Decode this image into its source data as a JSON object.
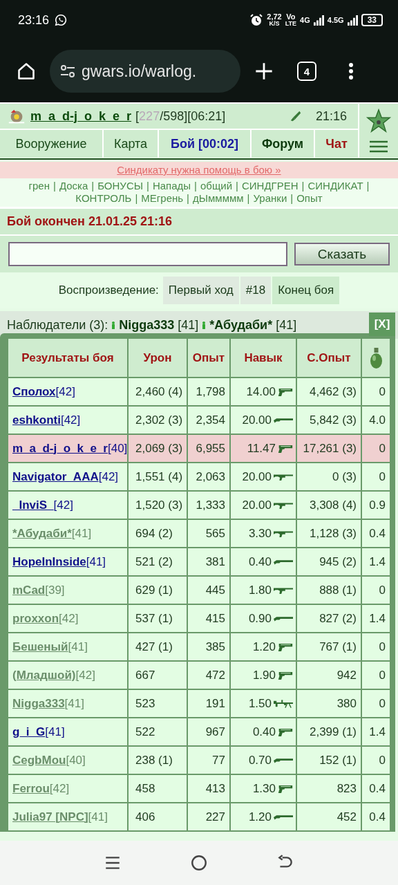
{
  "status_bar": {
    "time": "23:16",
    "speed": "2,72",
    "speed_unit": "K/S",
    "volte_top": "Vo",
    "volte_bottom": "LTE",
    "net_1": "4G",
    "net_2": "4.5G",
    "battery": "33"
  },
  "browser": {
    "url": "gwars.io/warlog.",
    "tab_count": "4"
  },
  "header": {
    "player": "m_a_d-j_o_k_e_r",
    "bracket": "[",
    "hp": "227",
    "hp_rest": "/598][06:21]",
    "time": "21:16"
  },
  "tabs": [
    {
      "label": "Вооружение",
      "kind": "plain"
    },
    {
      "label": "Карта",
      "kind": "plain"
    },
    {
      "label": "Бой [00:02]",
      "kind": "battle"
    },
    {
      "label": "Форум",
      "kind": "bold"
    },
    {
      "label": "Чат",
      "kind": "chat"
    }
  ],
  "banner": "Синдикату нужна помощь в бою »",
  "links": {
    "separator": "|",
    "items": [
      "грен",
      "Доска",
      "БОНУСЫ",
      "Напады",
      "общий",
      "СИНДГРЕН",
      "СИНДИКАТ",
      "КОНТРОЛЬ",
      "МЕгрень",
      "дЫммммм",
      "Уранки",
      "Опыт"
    ]
  },
  "battle_status": "Бой окончен 21.01.25 21:16",
  "say_button": "Сказать",
  "playback": {
    "label": "Воспроизведение:",
    "buttons": [
      {
        "label": "Первый ход",
        "selected": false
      },
      {
        "label": "#18",
        "selected": false
      },
      {
        "label": "Конец боя",
        "selected": true
      }
    ]
  },
  "observers": {
    "label": "Наблюдатели (3):",
    "items": [
      {
        "name": "Nigga333",
        "rank": "[41]"
      },
      {
        "name": "*Абудаби*",
        "rank": "[41]"
      }
    ]
  },
  "close_button": "[X]",
  "table": {
    "columns": [
      "Результаты боя",
      "Урон",
      "Опыт",
      "Навык",
      "С.Опыт"
    ],
    "rows": [
      {
        "name": "Сполох",
        "rank": "[42]",
        "online": true,
        "highlighted": false,
        "damage": "2,460 (4)",
        "exp": "1,798",
        "skill": "14.00",
        "weapon": {
          "kind": "pistol"
        },
        "syn_exp": "4,462 (3)",
        "grenade": "0"
      },
      {
        "name": "eshkonti",
        "rank": "[42]",
        "online": true,
        "highlighted": false,
        "damage": "2,302 (3)",
        "exp": "2,354",
        "skill": "20.00",
        "weapon": {
          "kind": "shotgun"
        },
        "syn_exp": "5,842 (3)",
        "grenade": "4.0"
      },
      {
        "name": "m_a_d-j_o_k_e_r",
        "rank": "[40]",
        "online": true,
        "highlighted": true,
        "damage": "2,069 (3)",
        "exp": "6,955",
        "skill": "11.47",
        "weapon": {
          "kind": "pistol"
        },
        "syn_exp": "17,261 (3)",
        "grenade": "0"
      },
      {
        "name": "Navigator_AAA",
        "rank": "[42]",
        "online": true,
        "highlighted": false,
        "damage": "1,551 (4)",
        "exp": "2,063",
        "skill": "20.00",
        "weapon": {
          "kind": "rifle"
        },
        "syn_exp": "0 (3)",
        "grenade": "0"
      },
      {
        "name": "_InviS_",
        "rank": "[42]",
        "online": true,
        "highlighted": false,
        "damage": "1,520 (3)",
        "exp": "1,333",
        "skill": "20.00",
        "weapon": {
          "kind": "rifle"
        },
        "syn_exp": "3,308 (4)",
        "grenade": "0.9"
      },
      {
        "name": "*Абудаби*",
        "rank": "[41]",
        "online": false,
        "highlighted": false,
        "damage": "694 (2)",
        "exp": "565",
        "skill": "3.30",
        "weapon": {
          "kind": "rifle"
        },
        "syn_exp": "1,128 (3)",
        "grenade": "0.4"
      },
      {
        "name": "HopeInInside",
        "rank": "[41]",
        "online": true,
        "highlighted": false,
        "damage": "521 (2)",
        "exp": "381",
        "skill": "0.40",
        "weapon": {
          "kind": "shotgun"
        },
        "syn_exp": "945 (2)",
        "grenade": "1.4"
      },
      {
        "name": "mCad",
        "rank": "[39]",
        "online": false,
        "highlighted": false,
        "damage": "629 (1)",
        "exp": "445",
        "skill": "1.80",
        "weapon": {
          "kind": "rifle"
        },
        "syn_exp": "888 (1)",
        "grenade": "0"
      },
      {
        "name": "proxxon",
        "rank": "[42]",
        "online": false,
        "highlighted": false,
        "damage": "537 (1)",
        "exp": "415",
        "skill": "0.90",
        "weapon": {
          "kind": "shotgun"
        },
        "syn_exp": "827 (2)",
        "grenade": "1.4"
      },
      {
        "name": "Бешеный",
        "rank": "[41]",
        "online": false,
        "highlighted": false,
        "damage": "427 (1)",
        "exp": "385",
        "skill": "1.20",
        "weapon": {
          "kind": "pistol"
        },
        "syn_exp": "767 (1)",
        "grenade": "0"
      },
      {
        "name": "(Младшой)",
        "rank": "[42]",
        "online": false,
        "highlighted": false,
        "damage": "667",
        "exp": "472",
        "skill": "1.90",
        "weapon": {
          "kind": "pistol"
        },
        "syn_exp": "942",
        "grenade": "0"
      },
      {
        "name": "Nigga333",
        "rank": "[41]",
        "online": false,
        "highlighted": false,
        "damage": "523",
        "exp": "191",
        "skill": "1.50",
        "weapon": {
          "kind": "machinegun"
        },
        "syn_exp": "380",
        "grenade": "0"
      },
      {
        "name": "g_i_G",
        "rank": "[41]",
        "online": true,
        "highlighted": false,
        "damage": "522",
        "exp": "967",
        "skill": "0.40",
        "weapon": {
          "kind": "pistol"
        },
        "syn_exp": "2,399 (1)",
        "grenade": "1.4"
      },
      {
        "name": "CegbMou",
        "rank": "[40]",
        "online": false,
        "highlighted": false,
        "damage": "238 (1)",
        "exp": "77",
        "skill": "0.70",
        "weapon": {
          "kind": "shotgun"
        },
        "syn_exp": "152 (1)",
        "grenade": "0"
      },
      {
        "name": "Ferrou",
        "rank": "[42]",
        "online": false,
        "highlighted": false,
        "damage": "458",
        "exp": "413",
        "skill": "1.30",
        "weapon": {
          "kind": "pistol"
        },
        "syn_exp": "823",
        "grenade": "0.4"
      },
      {
        "name": "Julia97 [NPC]",
        "rank": "[41]",
        "online": false,
        "highlighted": false,
        "damage": "406",
        "exp": "227",
        "skill": "1.20",
        "weapon": {
          "kind": "shotgun"
        },
        "syn_exp": "452",
        "grenade": "0.4"
      }
    ]
  }
}
